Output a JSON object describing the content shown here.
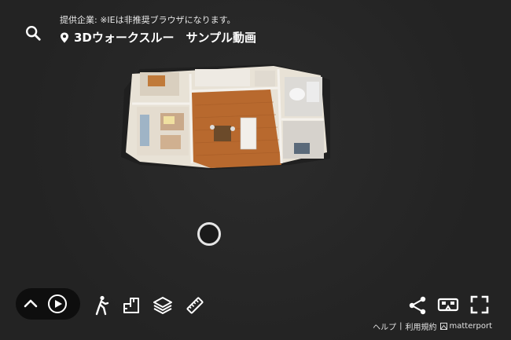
{
  "header": {
    "provider_text": "提供企業: ※IEは非推奨ブラウザになります。",
    "title": "3Dウォークスルー　サンプル動画"
  },
  "footer": {
    "help_label": "ヘルプ",
    "separator": "|",
    "terms_label": "利用規約",
    "brand_label": "matterport"
  },
  "icons": {
    "search": "search-icon",
    "location": "location-pin-icon",
    "collapse": "chevron-up-icon",
    "play": "play-icon",
    "walk": "walking-person-icon",
    "floorplan": "floor-plan-icon",
    "dollhouse": "dollhouse-icon",
    "measure": "ruler-icon",
    "share": "share-icon",
    "vr": "vr-headset-icon",
    "fullscreen": "fullscreen-icon"
  },
  "colors": {
    "background": "#262626",
    "floor_wood": "#b8692e",
    "walls": "#e8e2d6"
  }
}
